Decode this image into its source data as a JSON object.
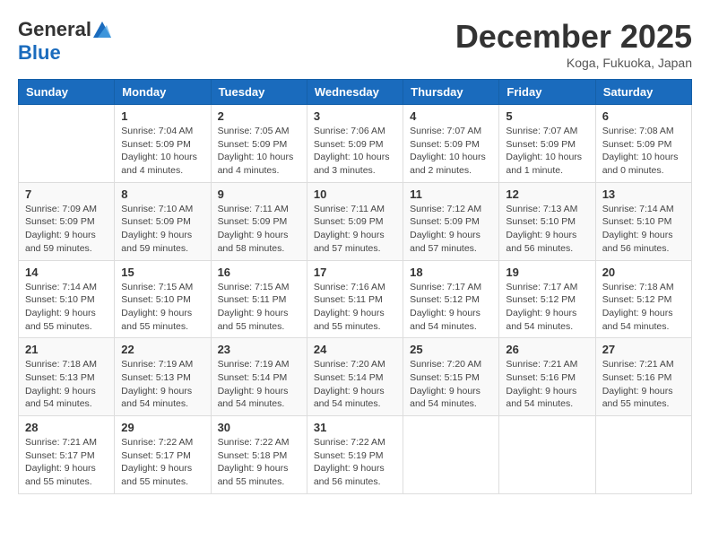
{
  "header": {
    "logo_general": "General",
    "logo_blue": "Blue",
    "month_title": "December 2025",
    "location": "Koga, Fukuoka, Japan"
  },
  "days_of_week": [
    "Sunday",
    "Monday",
    "Tuesday",
    "Wednesday",
    "Thursday",
    "Friday",
    "Saturday"
  ],
  "weeks": [
    [
      {
        "day": "",
        "info": ""
      },
      {
        "day": "1",
        "info": "Sunrise: 7:04 AM\nSunset: 5:09 PM\nDaylight: 10 hours\nand 4 minutes."
      },
      {
        "day": "2",
        "info": "Sunrise: 7:05 AM\nSunset: 5:09 PM\nDaylight: 10 hours\nand 4 minutes."
      },
      {
        "day": "3",
        "info": "Sunrise: 7:06 AM\nSunset: 5:09 PM\nDaylight: 10 hours\nand 3 minutes."
      },
      {
        "day": "4",
        "info": "Sunrise: 7:07 AM\nSunset: 5:09 PM\nDaylight: 10 hours\nand 2 minutes."
      },
      {
        "day": "5",
        "info": "Sunrise: 7:07 AM\nSunset: 5:09 PM\nDaylight: 10 hours\nand 1 minute."
      },
      {
        "day": "6",
        "info": "Sunrise: 7:08 AM\nSunset: 5:09 PM\nDaylight: 10 hours\nand 0 minutes."
      }
    ],
    [
      {
        "day": "7",
        "info": "Sunrise: 7:09 AM\nSunset: 5:09 PM\nDaylight: 9 hours\nand 59 minutes."
      },
      {
        "day": "8",
        "info": "Sunrise: 7:10 AM\nSunset: 5:09 PM\nDaylight: 9 hours\nand 59 minutes."
      },
      {
        "day": "9",
        "info": "Sunrise: 7:11 AM\nSunset: 5:09 PM\nDaylight: 9 hours\nand 58 minutes."
      },
      {
        "day": "10",
        "info": "Sunrise: 7:11 AM\nSunset: 5:09 PM\nDaylight: 9 hours\nand 57 minutes."
      },
      {
        "day": "11",
        "info": "Sunrise: 7:12 AM\nSunset: 5:09 PM\nDaylight: 9 hours\nand 57 minutes."
      },
      {
        "day": "12",
        "info": "Sunrise: 7:13 AM\nSunset: 5:10 PM\nDaylight: 9 hours\nand 56 minutes."
      },
      {
        "day": "13",
        "info": "Sunrise: 7:14 AM\nSunset: 5:10 PM\nDaylight: 9 hours\nand 56 minutes."
      }
    ],
    [
      {
        "day": "14",
        "info": "Sunrise: 7:14 AM\nSunset: 5:10 PM\nDaylight: 9 hours\nand 55 minutes."
      },
      {
        "day": "15",
        "info": "Sunrise: 7:15 AM\nSunset: 5:10 PM\nDaylight: 9 hours\nand 55 minutes."
      },
      {
        "day": "16",
        "info": "Sunrise: 7:15 AM\nSunset: 5:11 PM\nDaylight: 9 hours\nand 55 minutes."
      },
      {
        "day": "17",
        "info": "Sunrise: 7:16 AM\nSunset: 5:11 PM\nDaylight: 9 hours\nand 55 minutes."
      },
      {
        "day": "18",
        "info": "Sunrise: 7:17 AM\nSunset: 5:12 PM\nDaylight: 9 hours\nand 54 minutes."
      },
      {
        "day": "19",
        "info": "Sunrise: 7:17 AM\nSunset: 5:12 PM\nDaylight: 9 hours\nand 54 minutes."
      },
      {
        "day": "20",
        "info": "Sunrise: 7:18 AM\nSunset: 5:12 PM\nDaylight: 9 hours\nand 54 minutes."
      }
    ],
    [
      {
        "day": "21",
        "info": "Sunrise: 7:18 AM\nSunset: 5:13 PM\nDaylight: 9 hours\nand 54 minutes."
      },
      {
        "day": "22",
        "info": "Sunrise: 7:19 AM\nSunset: 5:13 PM\nDaylight: 9 hours\nand 54 minutes."
      },
      {
        "day": "23",
        "info": "Sunrise: 7:19 AM\nSunset: 5:14 PM\nDaylight: 9 hours\nand 54 minutes."
      },
      {
        "day": "24",
        "info": "Sunrise: 7:20 AM\nSunset: 5:14 PM\nDaylight: 9 hours\nand 54 minutes."
      },
      {
        "day": "25",
        "info": "Sunrise: 7:20 AM\nSunset: 5:15 PM\nDaylight: 9 hours\nand 54 minutes."
      },
      {
        "day": "26",
        "info": "Sunrise: 7:21 AM\nSunset: 5:16 PM\nDaylight: 9 hours\nand 54 minutes."
      },
      {
        "day": "27",
        "info": "Sunrise: 7:21 AM\nSunset: 5:16 PM\nDaylight: 9 hours\nand 55 minutes."
      }
    ],
    [
      {
        "day": "28",
        "info": "Sunrise: 7:21 AM\nSunset: 5:17 PM\nDaylight: 9 hours\nand 55 minutes."
      },
      {
        "day": "29",
        "info": "Sunrise: 7:22 AM\nSunset: 5:17 PM\nDaylight: 9 hours\nand 55 minutes."
      },
      {
        "day": "30",
        "info": "Sunrise: 7:22 AM\nSunset: 5:18 PM\nDaylight: 9 hours\nand 55 minutes."
      },
      {
        "day": "31",
        "info": "Sunrise: 7:22 AM\nSunset: 5:19 PM\nDaylight: 9 hours\nand 56 minutes."
      },
      {
        "day": "",
        "info": ""
      },
      {
        "day": "",
        "info": ""
      },
      {
        "day": "",
        "info": ""
      }
    ]
  ]
}
